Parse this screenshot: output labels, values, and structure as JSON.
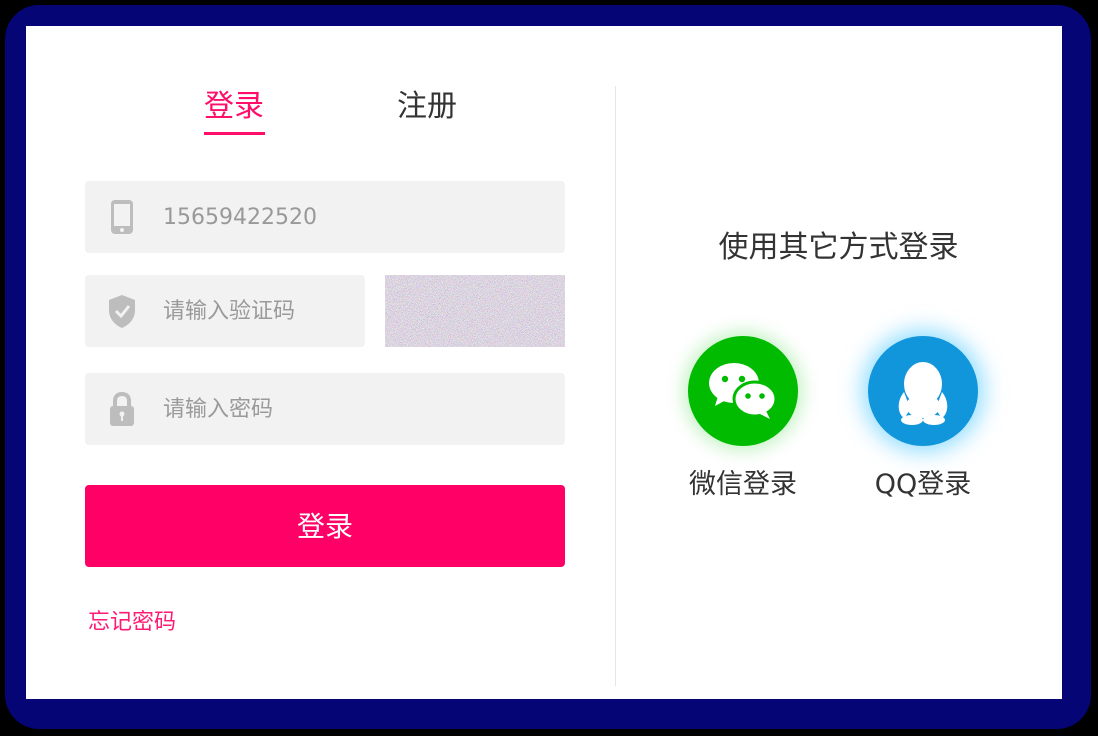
{
  "tabs": {
    "login": "登录",
    "register": "注册"
  },
  "form": {
    "phone_value": "15659422520",
    "code_placeholder": "请输入验证码",
    "password_placeholder": "请输入密码",
    "submit_label": "登录",
    "forgot_label": "忘记密码"
  },
  "other": {
    "title": "使用其它方式登录",
    "wechat_label": "微信登录",
    "qq_label": "QQ登录"
  },
  "colors": {
    "accent": "#ff0066",
    "wechat": "#00bb00",
    "qq": "#1296db",
    "frame": "#050575"
  },
  "icons": [
    "phone-icon",
    "shield-icon",
    "lock-icon",
    "wechat-icon",
    "qq-icon"
  ]
}
